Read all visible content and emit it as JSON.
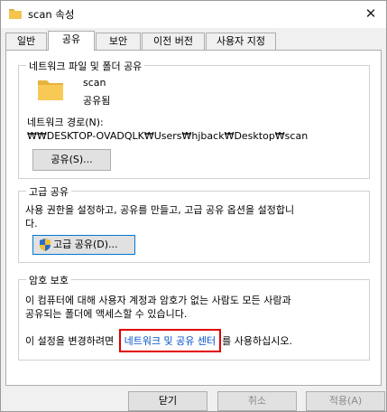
{
  "window": {
    "title": "scan 속성",
    "close": "✕"
  },
  "tabs": [
    "일반",
    "공유",
    "보안",
    "이전 버전",
    "사용자 지정"
  ],
  "network_share": {
    "group_title": "네트워크 파일 및 폴더 공유",
    "folder_name": "scan",
    "status": "공유됨",
    "path_label": "네트워크 경로(N):",
    "path_value": "₩₩DESKTOP-OVADQLK₩Users₩hjback₩Desktop₩scan",
    "share_button": "공유(S)..."
  },
  "advanced_share": {
    "group_title": "고급 공유",
    "description": "사용 권한을 설정하고, 공유를 만들고, 고급 공유 옵션을 설정합니다.",
    "description_line1": "사용 권한을 설정하고, 공유를 만들고, 고급 공유 옵션을 설정합니",
    "description_line2": "다.",
    "button": "고급 공유(D)..."
  },
  "password_protection": {
    "group_title": "암호 보호",
    "line1": "이 컴퓨터에 대해 사용자 계정과 암호가 없는 사람도 모든 사람과",
    "line2": "공유되는 폴더에 액세스할 수 있습니다.",
    "line3_prefix": "이 설정을 변경하려면",
    "link": "네트워크 및 공유 센터",
    "line3_suffix": "를 사용하십시오."
  },
  "buttons": {
    "close": "닫기",
    "cancel": "취소",
    "apply": "적용(A)"
  },
  "colors": {
    "highlight": "#e00000",
    "link": "#0050c8",
    "folder": "#f5c44c",
    "shield_blue": "#2a6ad0",
    "shield_yellow": "#f2c12e"
  }
}
